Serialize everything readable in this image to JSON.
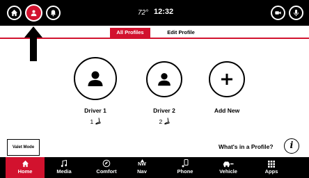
{
  "status_bar": {
    "temperature": "72°",
    "time": "12:32",
    "left_buttons": [
      "home-icon",
      "profile-icon",
      "notification-icon"
    ],
    "right_buttons": [
      "camera-icon",
      "microphone-icon"
    ]
  },
  "tabs": [
    {
      "label": "All Profiles",
      "active": true
    },
    {
      "label": "Edit Profile",
      "active": false
    }
  ],
  "profiles": [
    {
      "name": "Driver 1",
      "seat_memory": "1",
      "icon": "person-icon"
    },
    {
      "name": "Driver 2",
      "seat_memory": "2",
      "icon": "person-icon"
    },
    {
      "name": "Add New",
      "icon": "plus-icon"
    }
  ],
  "valet_mode": {
    "label": "Valet Mode"
  },
  "info": {
    "label": "What's in a Profile?",
    "icon_text": "i"
  },
  "bottom_nav": {
    "items": [
      {
        "label": "Home",
        "icon": "home-icon",
        "active": true
      },
      {
        "label": "Media",
        "icon": "music-note-icon",
        "active": false
      },
      {
        "label": "Comfort",
        "icon": "climate-icon",
        "active": false
      },
      {
        "label": "Nav",
        "icon": "compass-icon",
        "icon_text": "NW",
        "active": false
      },
      {
        "label": "Phone",
        "icon": "phone-icon",
        "active": false
      },
      {
        "label": "Vehicle",
        "icon": "car-icon",
        "active": false
      },
      {
        "label": "Apps",
        "icon": "grid-icon",
        "active": false
      }
    ]
  },
  "colors": {
    "accent": "#d2122e",
    "bar": "#000000",
    "background": "#ffffff"
  }
}
